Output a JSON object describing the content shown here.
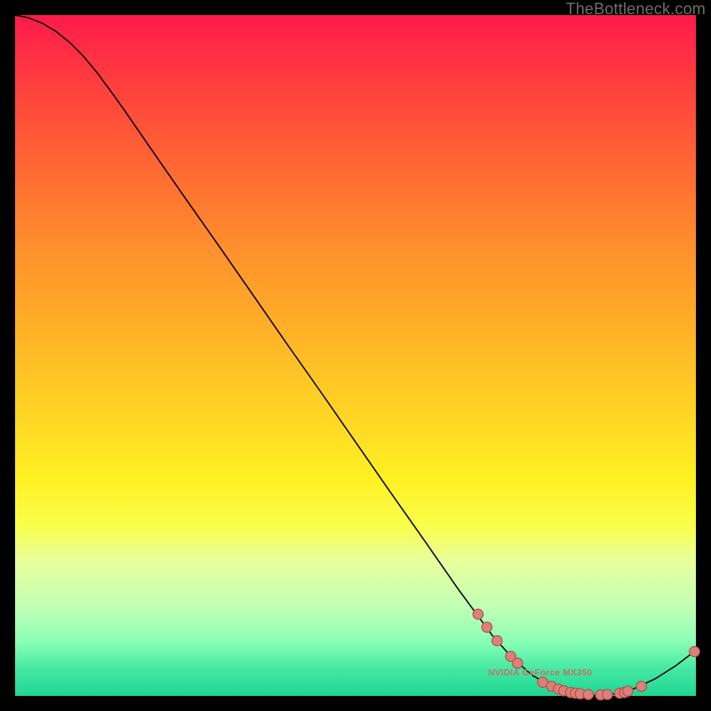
{
  "watermark": "TheBottleneck.com",
  "gpu_label": "NVIDIA GeForce MX350",
  "colors": {
    "curve": "#000000",
    "marker_fill": "#dc8079",
    "marker_stroke": "#b0554f",
    "label": "#c87066"
  },
  "chart_data": {
    "type": "line",
    "title": "",
    "xlabel": "",
    "ylabel": "",
    "xlim": [
      0,
      100
    ],
    "ylim": [
      0,
      100
    ],
    "grid": false,
    "legend": false,
    "curve": [
      {
        "x": 0,
        "y": 100.0
      },
      {
        "x": 2,
        "y": 99.6
      },
      {
        "x": 4,
        "y": 98.8
      },
      {
        "x": 6,
        "y": 97.6
      },
      {
        "x": 8,
        "y": 96.0
      },
      {
        "x": 10,
        "y": 94.0
      },
      {
        "x": 12,
        "y": 91.6
      },
      {
        "x": 14,
        "y": 88.9
      },
      {
        "x": 16,
        "y": 86.1
      },
      {
        "x": 20,
        "y": 80.3
      },
      {
        "x": 25,
        "y": 73.1
      },
      {
        "x": 30,
        "y": 66.0
      },
      {
        "x": 35,
        "y": 58.8
      },
      {
        "x": 40,
        "y": 51.6
      },
      {
        "x": 45,
        "y": 44.5
      },
      {
        "x": 50,
        "y": 37.3
      },
      {
        "x": 55,
        "y": 30.1
      },
      {
        "x": 60,
        "y": 23.0
      },
      {
        "x": 65,
        "y": 15.8
      },
      {
        "x": 70,
        "y": 9.0
      },
      {
        "x": 73,
        "y": 5.6
      },
      {
        "x": 76,
        "y": 3.0
      },
      {
        "x": 79,
        "y": 1.3
      },
      {
        "x": 82,
        "y": 0.4
      },
      {
        "x": 85,
        "y": 0.1
      },
      {
        "x": 88,
        "y": 0.3
      },
      {
        "x": 91,
        "y": 1.1
      },
      {
        "x": 94,
        "y": 2.5
      },
      {
        "x": 97,
        "y": 4.4
      },
      {
        "x": 100,
        "y": 6.7
      }
    ],
    "markers": [
      {
        "x": 68.0,
        "y": 12.0
      },
      {
        "x": 69.3,
        "y": 10.1
      },
      {
        "x": 70.8,
        "y": 8.1
      },
      {
        "x": 72.8,
        "y": 5.8
      },
      {
        "x": 73.8,
        "y": 4.8
      },
      {
        "x": 77.5,
        "y": 2.0
      },
      {
        "x": 78.8,
        "y": 1.4
      },
      {
        "x": 79.8,
        "y": 1.0
      },
      {
        "x": 80.6,
        "y": 0.75
      },
      {
        "x": 81.6,
        "y": 0.5
      },
      {
        "x": 82.3,
        "y": 0.4
      },
      {
        "x": 83.0,
        "y": 0.3
      },
      {
        "x": 84.2,
        "y": 0.2
      },
      {
        "x": 86.0,
        "y": 0.15
      },
      {
        "x": 87.0,
        "y": 0.2
      },
      {
        "x": 88.8,
        "y": 0.4
      },
      {
        "x": 89.5,
        "y": 0.5
      },
      {
        "x": 90.0,
        "y": 0.7
      },
      {
        "x": 92.0,
        "y": 1.4
      },
      {
        "x": 99.8,
        "y": 6.5
      }
    ],
    "gpu_label_position": {
      "x": 76.0,
      "y": 2.5
    }
  }
}
